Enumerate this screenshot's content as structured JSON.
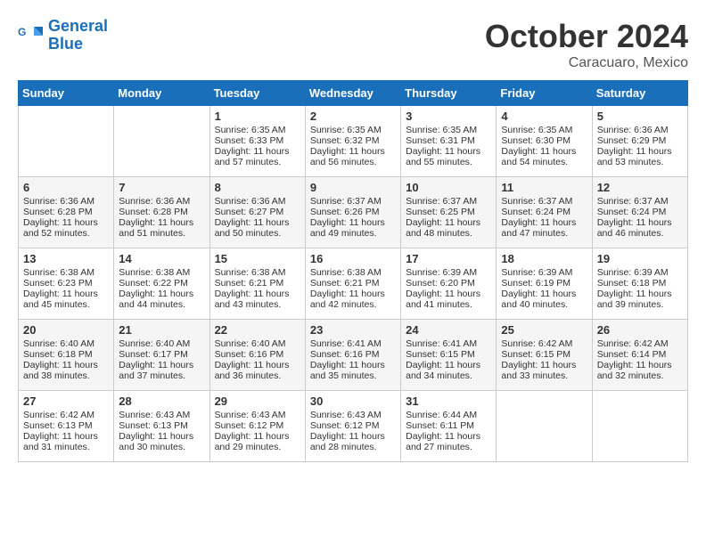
{
  "header": {
    "logo_line1": "General",
    "logo_line2": "Blue",
    "month": "October 2024",
    "location": "Caracuaro, Mexico"
  },
  "days_of_week": [
    "Sunday",
    "Monday",
    "Tuesday",
    "Wednesday",
    "Thursday",
    "Friday",
    "Saturday"
  ],
  "weeks": [
    [
      {
        "day": "",
        "info": ""
      },
      {
        "day": "",
        "info": ""
      },
      {
        "day": "1",
        "info": "Sunrise: 6:35 AM\nSunset: 6:33 PM\nDaylight: 11 hours\nand 57 minutes."
      },
      {
        "day": "2",
        "info": "Sunrise: 6:35 AM\nSunset: 6:32 PM\nDaylight: 11 hours\nand 56 minutes."
      },
      {
        "day": "3",
        "info": "Sunrise: 6:35 AM\nSunset: 6:31 PM\nDaylight: 11 hours\nand 55 minutes."
      },
      {
        "day": "4",
        "info": "Sunrise: 6:35 AM\nSunset: 6:30 PM\nDaylight: 11 hours\nand 54 minutes."
      },
      {
        "day": "5",
        "info": "Sunrise: 6:36 AM\nSunset: 6:29 PM\nDaylight: 11 hours\nand 53 minutes."
      }
    ],
    [
      {
        "day": "6",
        "info": "Sunrise: 6:36 AM\nSunset: 6:28 PM\nDaylight: 11 hours\nand 52 minutes."
      },
      {
        "day": "7",
        "info": "Sunrise: 6:36 AM\nSunset: 6:28 PM\nDaylight: 11 hours\nand 51 minutes."
      },
      {
        "day": "8",
        "info": "Sunrise: 6:36 AM\nSunset: 6:27 PM\nDaylight: 11 hours\nand 50 minutes."
      },
      {
        "day": "9",
        "info": "Sunrise: 6:37 AM\nSunset: 6:26 PM\nDaylight: 11 hours\nand 49 minutes."
      },
      {
        "day": "10",
        "info": "Sunrise: 6:37 AM\nSunset: 6:25 PM\nDaylight: 11 hours\nand 48 minutes."
      },
      {
        "day": "11",
        "info": "Sunrise: 6:37 AM\nSunset: 6:24 PM\nDaylight: 11 hours\nand 47 minutes."
      },
      {
        "day": "12",
        "info": "Sunrise: 6:37 AM\nSunset: 6:24 PM\nDaylight: 11 hours\nand 46 minutes."
      }
    ],
    [
      {
        "day": "13",
        "info": "Sunrise: 6:38 AM\nSunset: 6:23 PM\nDaylight: 11 hours\nand 45 minutes."
      },
      {
        "day": "14",
        "info": "Sunrise: 6:38 AM\nSunset: 6:22 PM\nDaylight: 11 hours\nand 44 minutes."
      },
      {
        "day": "15",
        "info": "Sunrise: 6:38 AM\nSunset: 6:21 PM\nDaylight: 11 hours\nand 43 minutes."
      },
      {
        "day": "16",
        "info": "Sunrise: 6:38 AM\nSunset: 6:21 PM\nDaylight: 11 hours\nand 42 minutes."
      },
      {
        "day": "17",
        "info": "Sunrise: 6:39 AM\nSunset: 6:20 PM\nDaylight: 11 hours\nand 41 minutes."
      },
      {
        "day": "18",
        "info": "Sunrise: 6:39 AM\nSunset: 6:19 PM\nDaylight: 11 hours\nand 40 minutes."
      },
      {
        "day": "19",
        "info": "Sunrise: 6:39 AM\nSunset: 6:18 PM\nDaylight: 11 hours\nand 39 minutes."
      }
    ],
    [
      {
        "day": "20",
        "info": "Sunrise: 6:40 AM\nSunset: 6:18 PM\nDaylight: 11 hours\nand 38 minutes."
      },
      {
        "day": "21",
        "info": "Sunrise: 6:40 AM\nSunset: 6:17 PM\nDaylight: 11 hours\nand 37 minutes."
      },
      {
        "day": "22",
        "info": "Sunrise: 6:40 AM\nSunset: 6:16 PM\nDaylight: 11 hours\nand 36 minutes."
      },
      {
        "day": "23",
        "info": "Sunrise: 6:41 AM\nSunset: 6:16 PM\nDaylight: 11 hours\nand 35 minutes."
      },
      {
        "day": "24",
        "info": "Sunrise: 6:41 AM\nSunset: 6:15 PM\nDaylight: 11 hours\nand 34 minutes."
      },
      {
        "day": "25",
        "info": "Sunrise: 6:42 AM\nSunset: 6:15 PM\nDaylight: 11 hours\nand 33 minutes."
      },
      {
        "day": "26",
        "info": "Sunrise: 6:42 AM\nSunset: 6:14 PM\nDaylight: 11 hours\nand 32 minutes."
      }
    ],
    [
      {
        "day": "27",
        "info": "Sunrise: 6:42 AM\nSunset: 6:13 PM\nDaylight: 11 hours\nand 31 minutes."
      },
      {
        "day": "28",
        "info": "Sunrise: 6:43 AM\nSunset: 6:13 PM\nDaylight: 11 hours\nand 30 minutes."
      },
      {
        "day": "29",
        "info": "Sunrise: 6:43 AM\nSunset: 6:12 PM\nDaylight: 11 hours\nand 29 minutes."
      },
      {
        "day": "30",
        "info": "Sunrise: 6:43 AM\nSunset: 6:12 PM\nDaylight: 11 hours\nand 28 minutes."
      },
      {
        "day": "31",
        "info": "Sunrise: 6:44 AM\nSunset: 6:11 PM\nDaylight: 11 hours\nand 27 minutes."
      },
      {
        "day": "",
        "info": ""
      },
      {
        "day": "",
        "info": ""
      }
    ]
  ]
}
